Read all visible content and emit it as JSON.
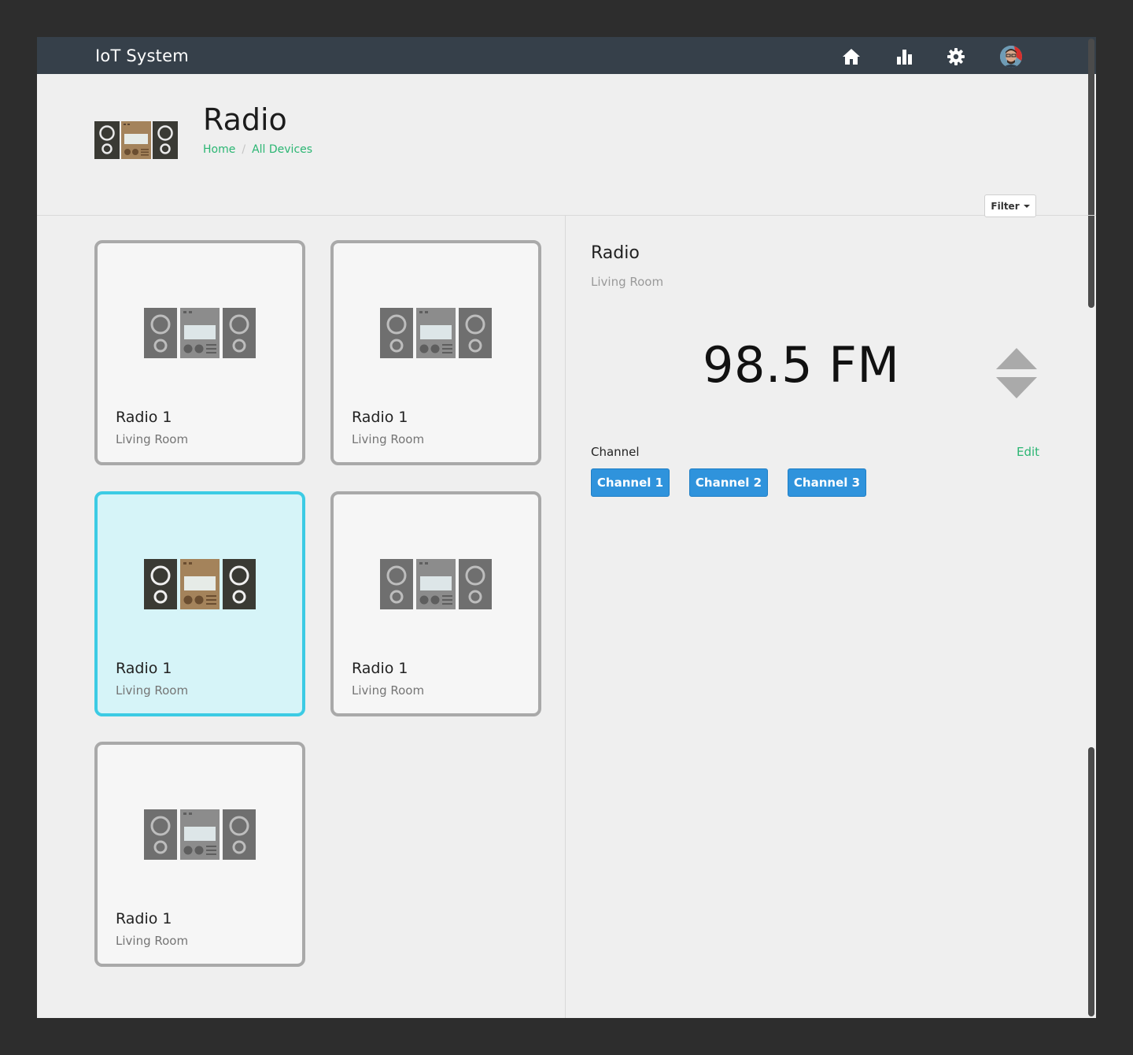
{
  "app": {
    "title": "IoT System"
  },
  "nav": {
    "icons": [
      "home-icon",
      "bar-chart-icon",
      "gear-icon",
      "user-avatar"
    ]
  },
  "header": {
    "title": "Radio",
    "breadcrumb": [
      {
        "label": "Home"
      },
      {
        "label": "All Devices"
      }
    ],
    "filter_label": "Filter"
  },
  "devices": [
    {
      "name": "Radio 1",
      "room": "Living Room",
      "selected": false
    },
    {
      "name": "Radio 1",
      "room": "Living Room",
      "selected": false
    },
    {
      "name": "Radio 1",
      "room": "Living Room",
      "selected": true
    },
    {
      "name": "Radio 1",
      "room": "Living Room",
      "selected": false
    },
    {
      "name": "Radio 1",
      "room": "Living Room",
      "selected": false
    }
  ],
  "detail": {
    "title": "Radio",
    "room": "Living Room",
    "frequency": "98.5 FM",
    "channel_label": "Channel",
    "edit_label": "Edit",
    "channels": [
      "Channel 1",
      "Channel 2",
      "Channel 3"
    ]
  },
  "colors": {
    "navbar": "#36404a",
    "accent_green": "#2bb673",
    "selected_border": "#3ccbe4",
    "selected_bg": "#d6f4f8",
    "button_blue": "#2f93dc"
  }
}
